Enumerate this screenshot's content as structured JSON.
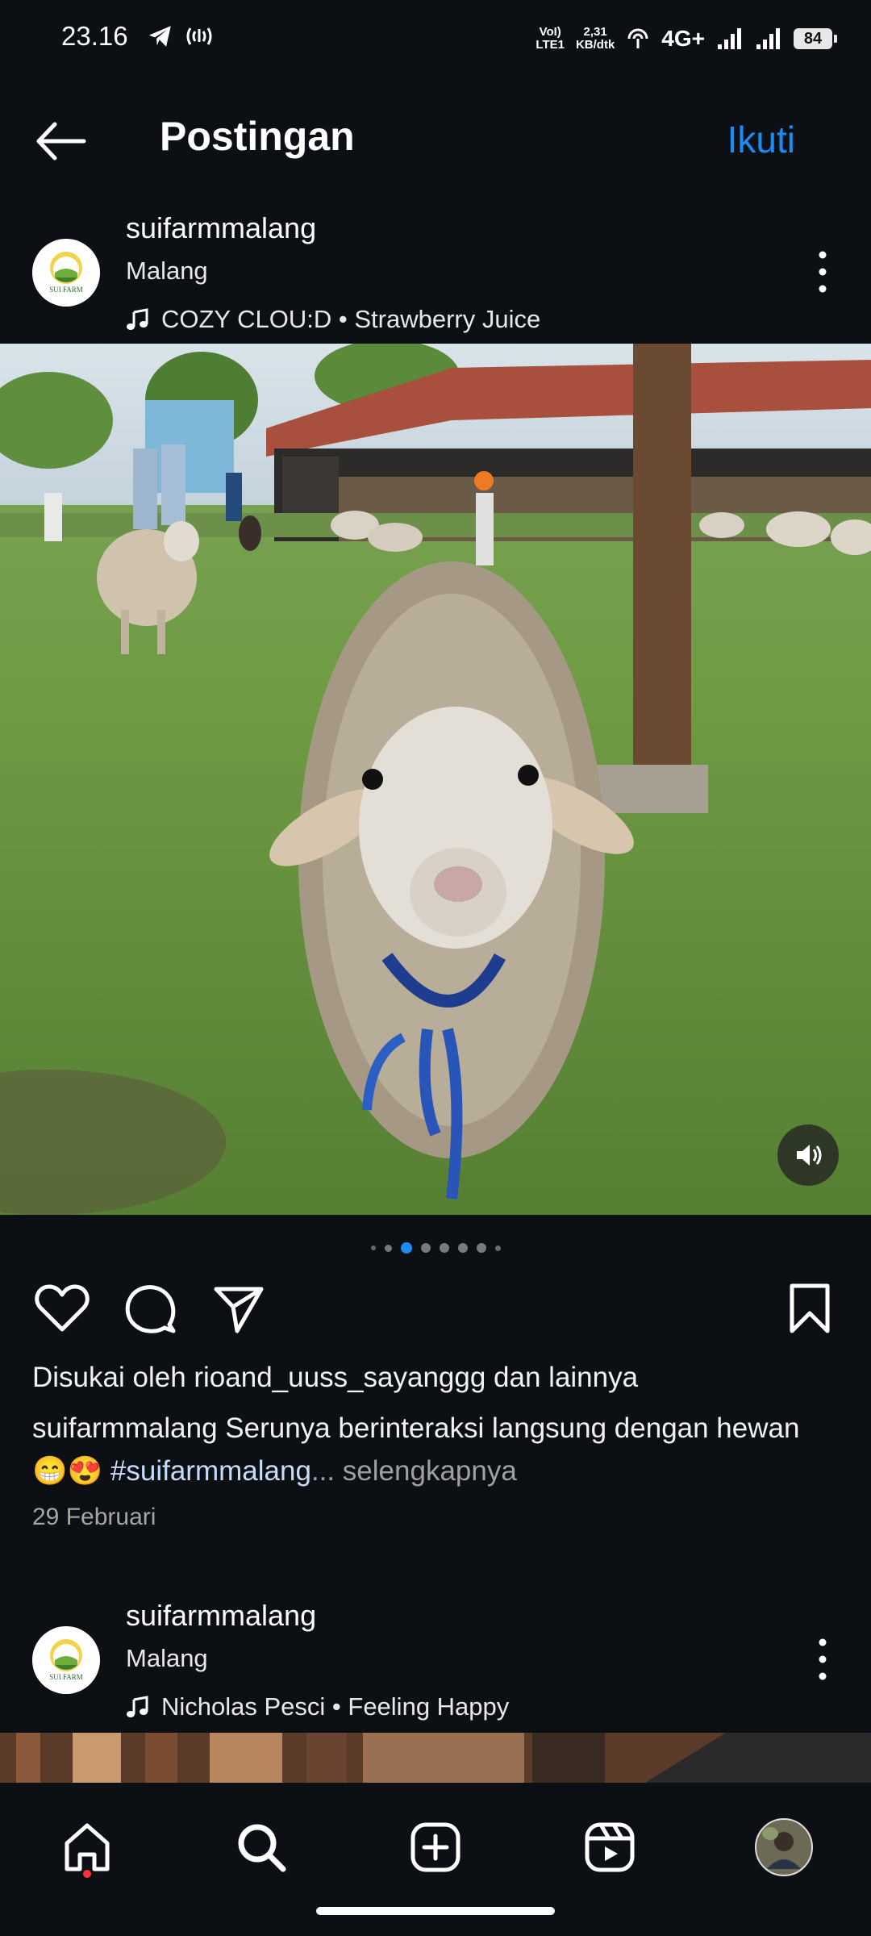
{
  "status_bar": {
    "time": "23.16",
    "volte_line1": "VoI)",
    "volte_line2": "LTE1",
    "speed_value": "2,31",
    "speed_unit": "KB/dtk",
    "network": "4G+",
    "battery": "84"
  },
  "header": {
    "title": "Postingan",
    "follow_label": "Ikuti"
  },
  "post": {
    "username": "suifarmmalang",
    "location": "Malang",
    "music": "COZY CLOU:D • Strawberry Juice",
    "avatar_text": "SUI FARM",
    "liked_by": "Disukai oleh rioand_uuss_sayanggg dan lainnya",
    "caption_user": "suifarmmalang",
    "caption_text": "Serunya berinteraksi langsung dengan hewan 😁😍",
    "caption_hashtag": "#suifarmmalang",
    "caption_more": "... selengkapnya",
    "date": "29 Februari",
    "carousel_active_index": 1,
    "carousel_dots": 7
  },
  "next_post": {
    "username": "suifarmmalang",
    "location": "Malang",
    "music": "Nicholas Pesci • Feeling Happy",
    "avatar_text": "SUI FARM"
  },
  "colors": {
    "background": "#0c1014",
    "accent": "#1a8cf2",
    "notification": "#ff3040"
  },
  "nav": {
    "items": [
      "home-icon",
      "search-icon",
      "create-icon",
      "reels-icon",
      "profile-avatar"
    ]
  }
}
